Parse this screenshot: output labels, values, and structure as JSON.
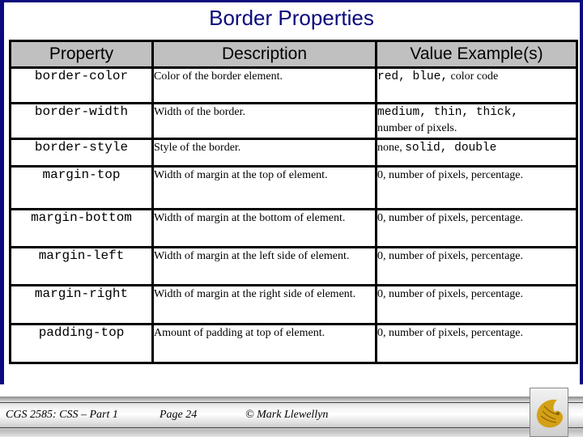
{
  "slide": {
    "title": "Border Properties",
    "colors": {
      "title": "#0b0b7e",
      "frame": "#0b0b7e",
      "header_bg": "#c0c0c0",
      "logo_gold": "#d4a017"
    }
  },
  "table": {
    "headers": [
      "Property",
      "Description",
      "Value Example(s)"
    ],
    "rows": [
      {
        "property": "border-color",
        "description": "Color of the border element.",
        "value_mono": "red, blue,",
        "value_text": "color code"
      },
      {
        "property": "border-width",
        "description": "Width of the border.",
        "value_mono": "medium, thin, thick,",
        "value_text": "number of pixels."
      },
      {
        "property": "border-style",
        "description": "Style of the border.",
        "value_pre": "none,",
        "value_mono": "solid, double"
      },
      {
        "property": "margin-top",
        "description": "Width of margin at the top of element.",
        "value_text": "0, number of pixels, percentage."
      },
      {
        "property": "margin-bottom",
        "description": "Width of margin at the bottom of element.",
        "value_text": "0, number of pixels, percentage."
      },
      {
        "property": "margin-left",
        "description": "Width of margin at the left side of element.",
        "value_text": "0, number of pixels, percentage."
      },
      {
        "property": "margin-right",
        "description": "Width of margin at the right side of element.",
        "value_text": "0, number of pixels, percentage."
      },
      {
        "property": "padding-top",
        "description": "Amount of padding at top of element.",
        "value_text": "0, number of pixels, percentage."
      }
    ]
  },
  "footer": {
    "course": "CGS 2585: CSS – Part 1",
    "page": "Page 24",
    "author": "© Mark Llewellyn",
    "logo_icon": "pegasus-logo-icon"
  }
}
